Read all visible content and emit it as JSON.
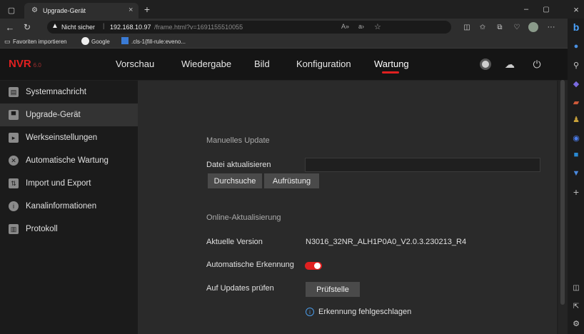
{
  "browser": {
    "tab_title": "Upgrade-Gerät",
    "security": "Nicht sicher",
    "url_host": "192.168.10.97",
    "url_path": "/frame.html?v=1691155510055",
    "favorites": [
      "Favoriten importieren",
      "Google",
      ".cls-1{fill-rule:eveno..."
    ]
  },
  "app": {
    "logo": "NVR",
    "logo_version": "6.0",
    "nav": [
      "Vorschau",
      "Wiedergabe",
      "Bild",
      "Konfiguration",
      "Wartung"
    ],
    "active_nav": "Wartung",
    "accent": "#e02020"
  },
  "sidebar": {
    "items": [
      {
        "label": "Systemnachricht",
        "icon": "message-icon"
      },
      {
        "label": "Upgrade-Gerät",
        "icon": "upgrade-icon"
      },
      {
        "label": "Werkseinstellungen",
        "icon": "reset-icon"
      },
      {
        "label": "Automatische Wartung",
        "icon": "wrench-icon"
      },
      {
        "label": "Import und Export",
        "icon": "import-export-icon"
      },
      {
        "label": "Kanalinformationen",
        "icon": "info-icon"
      },
      {
        "label": "Protokoll",
        "icon": "log-icon"
      }
    ],
    "active": "Upgrade-Gerät"
  },
  "manual": {
    "section": "Manuelles Update",
    "file_label": "Datei aktualisieren",
    "file_value": "",
    "browse": "Durchsuche",
    "upgrade": "Aufrüstung"
  },
  "online": {
    "section": "Online-Aktualisierung",
    "version_label": "Aktuelle Version",
    "version_value": "N3016_32NR_ALH1P0A0_V2.0.3.230213_R4",
    "auto_label": "Automatische Erkennung",
    "auto_on": true,
    "check_label": "Auf Updates prüfen",
    "check_button": "Prüfstelle",
    "status": "Erkennung fehlgeschlagen"
  }
}
